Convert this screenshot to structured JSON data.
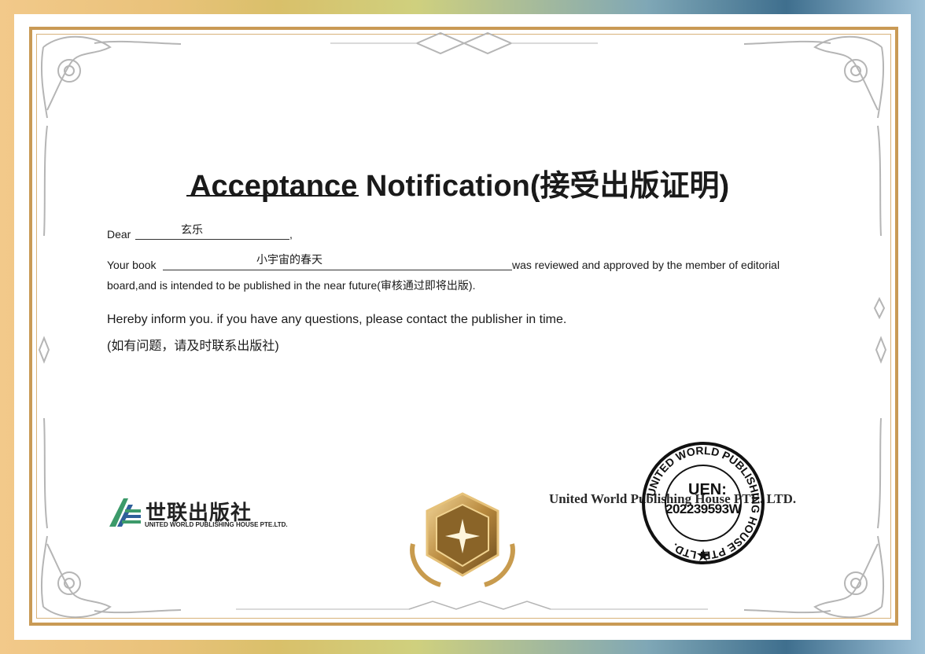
{
  "certificate": {
    "title_part1": "Acceptance",
    "title_part2": " Notification(接受出版证明)",
    "dear_label": "Dear",
    "dear_name": "玄乐",
    "dear_comma": ",",
    "book_label": "Your book",
    "book_title": "小宇宙的春天",
    "book_suffix": "was reviewed and approved by the member of editorial",
    "line2": "board,and is intended to be published in the near future(审核通过即将出版).",
    "inform_en": "Hereby inform you. if you have any questions, please contact the publisher in time.",
    "inform_cn": "(如有问题，请及时联系出版社)"
  },
  "logo": {
    "name_cn": "世联出版社",
    "name_en": "UNITED WORLD PUBLISHING HOUSE PTE.LTD."
  },
  "publisher_name": "United World Publishing House PTE. LTD.",
  "stamp": {
    "ring_text": "UNITED WORLD PUBLISHING HOUSE PTE. LTD.",
    "uen_label": "UEN:",
    "uen_number": "202239593W"
  },
  "colors": {
    "gold": "#c99a55",
    "ornament": "#b8b8b8",
    "logo_green": "#3c9a6a",
    "logo_blue": "#2f5f9a"
  }
}
